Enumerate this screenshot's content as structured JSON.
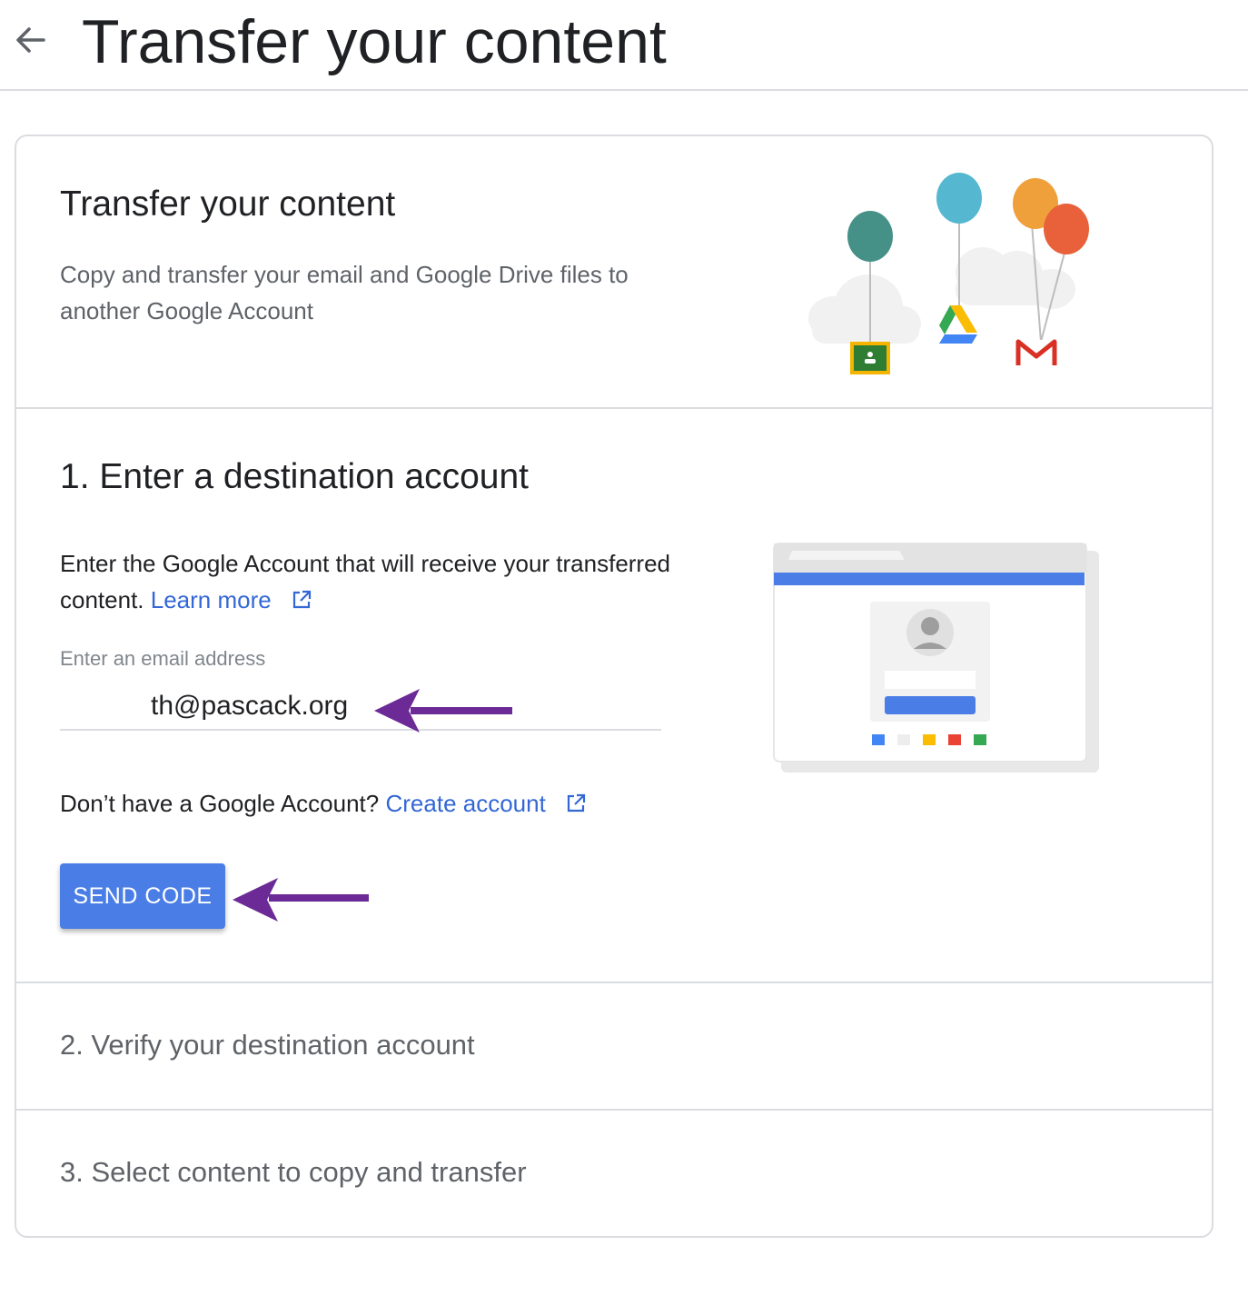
{
  "header": {
    "title": "Transfer your content"
  },
  "intro": {
    "title": "Transfer your content",
    "description": "Copy and transfer your email and Google Drive files to another Google Account"
  },
  "step1": {
    "title": "1. Enter a destination account",
    "description": "Enter the Google Account that will receive your transferred content.",
    "learn_more": "Learn more",
    "email_label": "Enter an email address",
    "email_value": "th@pascack.org",
    "no_account_text": "Don’t have a Google Account?",
    "create_account": "Create account",
    "send_code_label": "SEND CODE"
  },
  "step2": {
    "title": "2. Verify your destination account"
  },
  "step3": {
    "title": "3. Select content to copy and transfer"
  },
  "colors": {
    "accent": "#4a7ee6",
    "link": "#3367d6",
    "annotation_arrow": "#6b2a95"
  },
  "icons": {
    "back": "arrow-back-icon",
    "external": "open-in-new-icon"
  }
}
